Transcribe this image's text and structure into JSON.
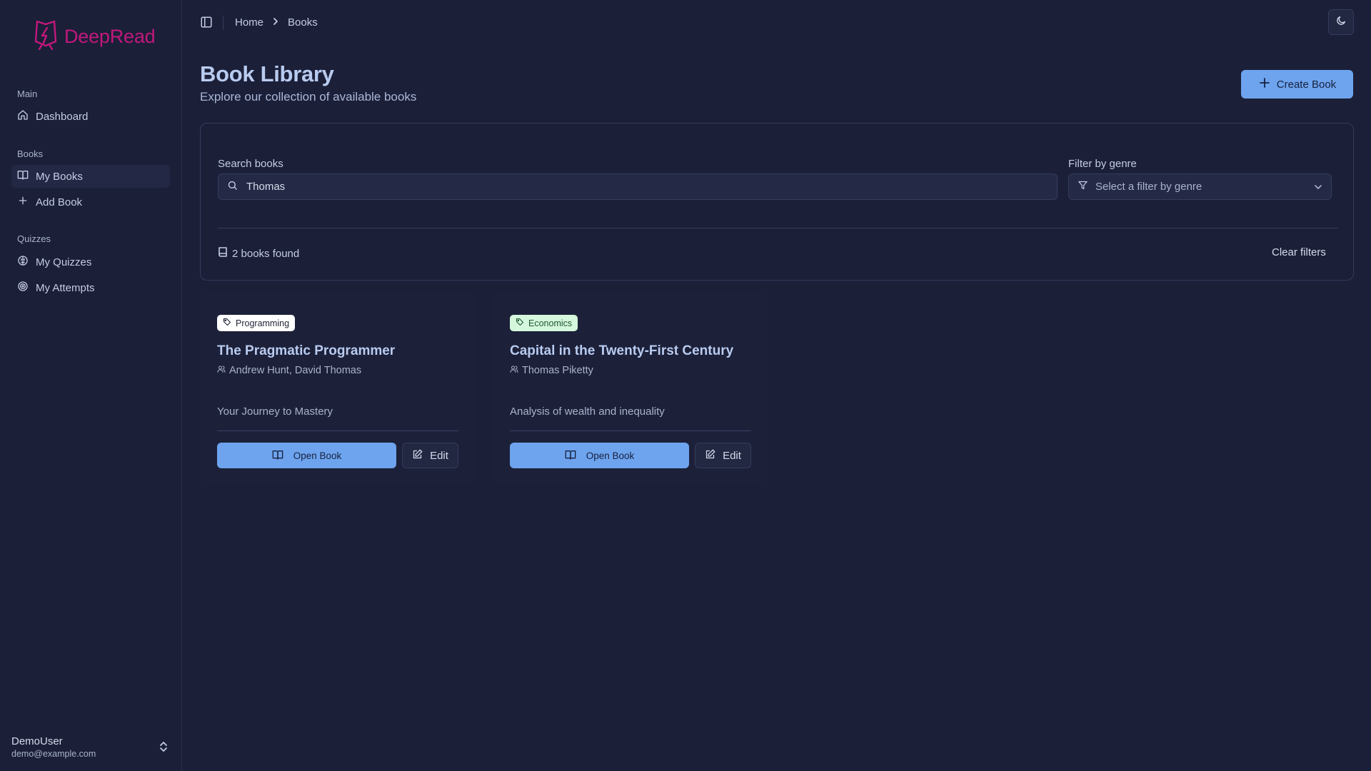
{
  "brand": {
    "name": "DeepRead",
    "color": "#c2187c"
  },
  "sidebar": {
    "groups": [
      {
        "label": "Main",
        "items": [
          {
            "label": "Dashboard",
            "icon": "home-icon"
          }
        ]
      },
      {
        "label": "Books",
        "items": [
          {
            "label": "My Books",
            "icon": "book-open-icon",
            "active": true
          },
          {
            "label": "Add Book",
            "icon": "plus-icon"
          }
        ]
      },
      {
        "label": "Quizzes",
        "items": [
          {
            "label": "My Quizzes",
            "icon": "brain-icon"
          },
          {
            "label": "My Attempts",
            "icon": "target-icon"
          }
        ]
      }
    ],
    "user": {
      "name": "DemoUser",
      "email": "demo@example.com"
    }
  },
  "breadcrumb": {
    "home": "Home",
    "current": "Books"
  },
  "header": {
    "title": "Book Library",
    "subtitle": "Explore our collection of available books",
    "create_label": "Create Book"
  },
  "filters": {
    "search_label": "Search books",
    "search_value": "Thomas",
    "genre_label": "Filter by genre",
    "genre_placeholder": "Select a filter by genre",
    "results": "2 books found",
    "clear_label": "Clear filters"
  },
  "books": [
    {
      "genre": "Programming",
      "title": "The Pragmatic Programmer",
      "authors": "Andrew Hunt, David Thomas",
      "description": "Your Journey to Mastery",
      "open_label": "Open Book",
      "edit_label": "Edit"
    },
    {
      "genre": "Economics",
      "title": "Capital in the Twenty-First Century",
      "authors": "Thomas Piketty",
      "description": "Analysis of wealth and inequality",
      "open_label": "Open Book",
      "edit_label": "Edit"
    }
  ],
  "colors": {
    "background": "#1b1f38",
    "accent": "#6ea4ee",
    "title": "#b9cbef"
  }
}
